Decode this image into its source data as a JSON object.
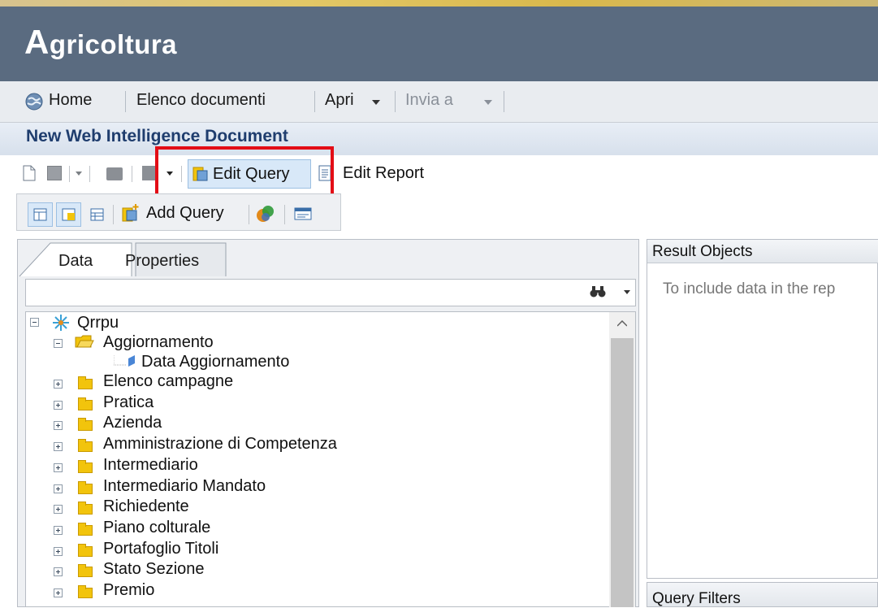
{
  "app": {
    "title_initial": "A",
    "title_rest": "gricoltura"
  },
  "nav": {
    "home": "Home",
    "elenco": "Elenco documenti",
    "apri": "Apri",
    "invia": "Invia a"
  },
  "document": {
    "title": "New Web Intelligence Document"
  },
  "toolbar": {
    "edit_query": "Edit Query",
    "edit_report": "Edit Report",
    "add_query": "Add Query"
  },
  "left_panel": {
    "tabs": [
      {
        "label": "Data",
        "active": true
      },
      {
        "label": "Properties",
        "active": false
      }
    ],
    "search": {
      "value": "",
      "placeholder": ""
    },
    "tree": {
      "root": "Qrrpu",
      "aggiornamento": {
        "label": "Aggiornamento",
        "child": "Data Aggiornamento"
      },
      "folders": [
        "Elenco campagne",
        "Pratica",
        "Azienda",
        "Amministrazione di Competenza",
        "Intermediario",
        "Intermediario Mandato",
        "Richiedente",
        "Piano colturale",
        "Portafoglio Titoli",
        "Stato Sezione",
        "Premio"
      ]
    }
  },
  "right_panel": {
    "result_title": "Result Objects",
    "result_hint": "To include data in the rep",
    "filters_title": "Query Filters"
  },
  "colors": {
    "banner": "#5a6b80",
    "highlight": "#e30d16",
    "doc_title": "#1f3d6e"
  }
}
